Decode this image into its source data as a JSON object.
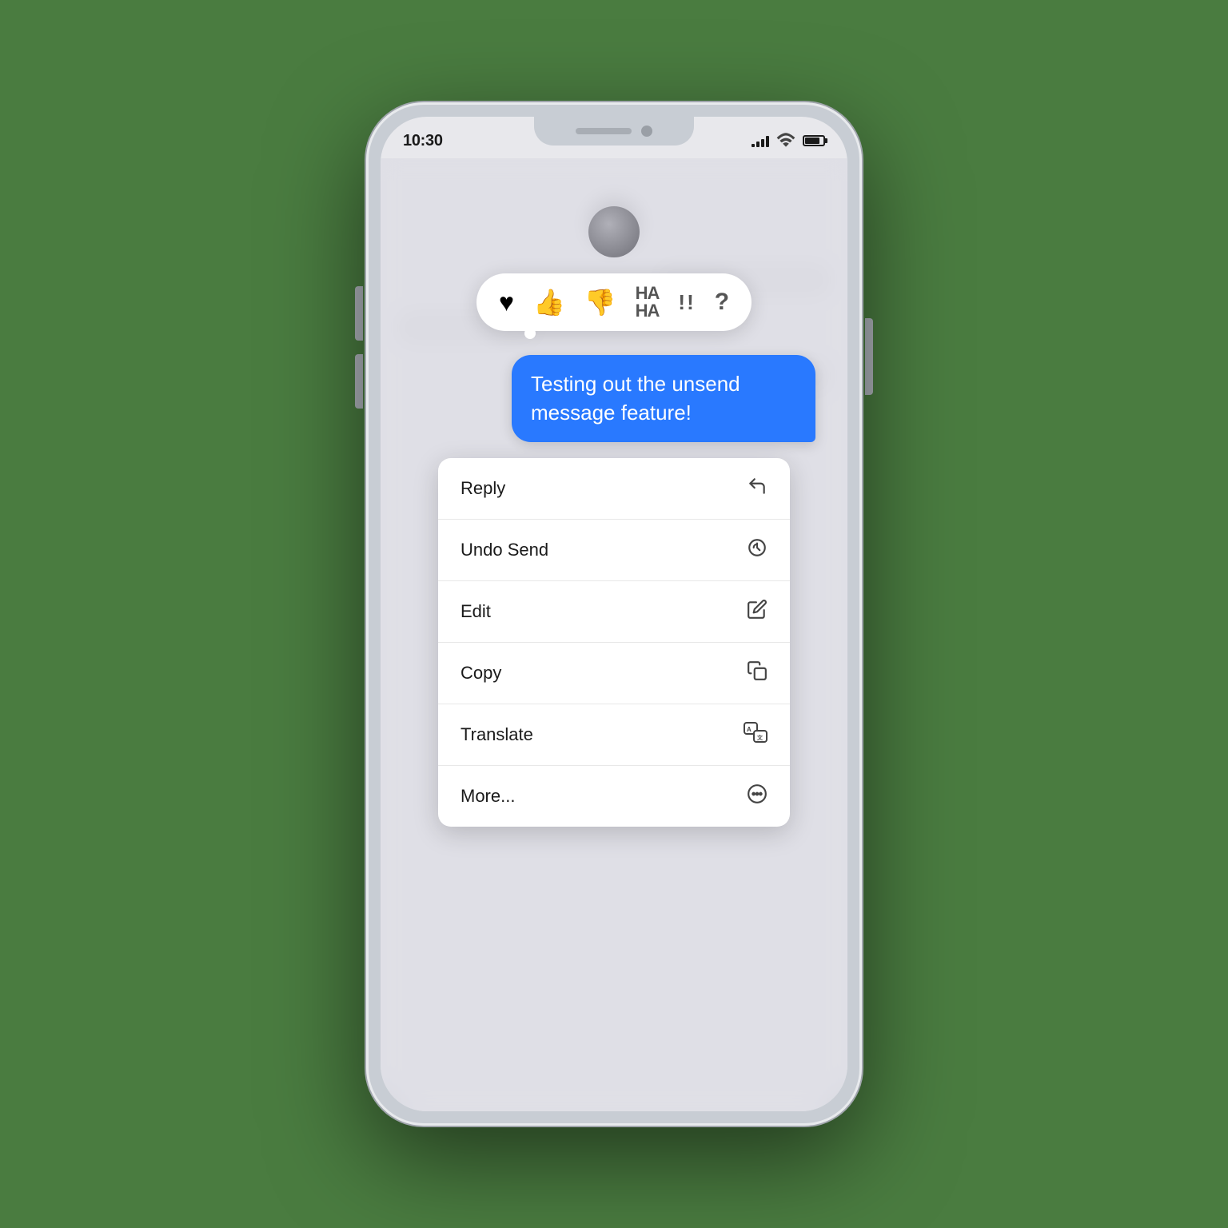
{
  "background_color": "#4a7c40",
  "phone": {
    "status_bar": {
      "time": "10:30",
      "signal_bars": 4,
      "wifi": true,
      "battery_percent": 80
    },
    "message": {
      "text": "Testing out the unsend message feature!",
      "bubble_color": "#2979ff",
      "text_color": "#ffffff"
    },
    "reaction_bar": {
      "reactions": [
        {
          "id": "heart",
          "symbol": "♥",
          "label": "Heart"
        },
        {
          "id": "thumbs-up",
          "symbol": "👍",
          "label": "Like"
        },
        {
          "id": "thumbs-down",
          "symbol": "👎",
          "label": "Dislike"
        },
        {
          "id": "haha",
          "symbol": "HA HA",
          "label": "Haha"
        },
        {
          "id": "exclaim",
          "symbol": "!!",
          "label": "Emphasis"
        },
        {
          "id": "question",
          "symbol": "?",
          "label": "Question"
        }
      ]
    },
    "context_menu": {
      "items": [
        {
          "id": "reply",
          "label": "Reply",
          "icon": "reply"
        },
        {
          "id": "undo-send",
          "label": "Undo Send",
          "icon": "undo-send"
        },
        {
          "id": "edit",
          "label": "Edit",
          "icon": "edit"
        },
        {
          "id": "copy",
          "label": "Copy",
          "icon": "copy"
        },
        {
          "id": "translate",
          "label": "Translate",
          "icon": "translate"
        },
        {
          "id": "more",
          "label": "More...",
          "icon": "more"
        }
      ]
    }
  }
}
